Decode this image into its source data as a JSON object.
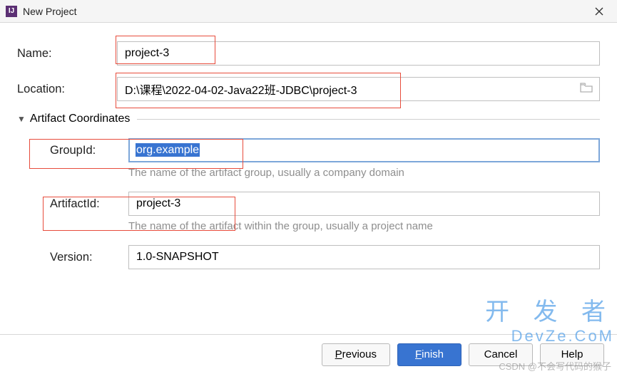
{
  "window": {
    "title": "New Project",
    "app_icon_text": "IJ"
  },
  "fields": {
    "name_label": "Name:",
    "name_value": "project-3",
    "location_label": "Location:",
    "location_value": "D:\\课程\\2022-04-02-Java22班-JDBC\\project-3"
  },
  "artifact_section": {
    "title": "Artifact Coordinates",
    "groupid_label": "GroupId:",
    "groupid_value": "org.example",
    "groupid_hint": "The name of the artifact group, usually a company domain",
    "artifactid_label": "ArtifactId:",
    "artifactid_value": "project-3",
    "artifactid_hint": "The name of the artifact within the group, usually a project name",
    "version_label": "Version:",
    "version_value": "1.0-SNAPSHOT"
  },
  "buttons": {
    "previous": "Previous",
    "finish": "Finish",
    "cancel": "Cancel",
    "help": "Help"
  },
  "watermark": {
    "cn": "开 发 者",
    "en": "DevZe.CoM",
    "csdn": "CSDN @不会写代码的猴子"
  }
}
